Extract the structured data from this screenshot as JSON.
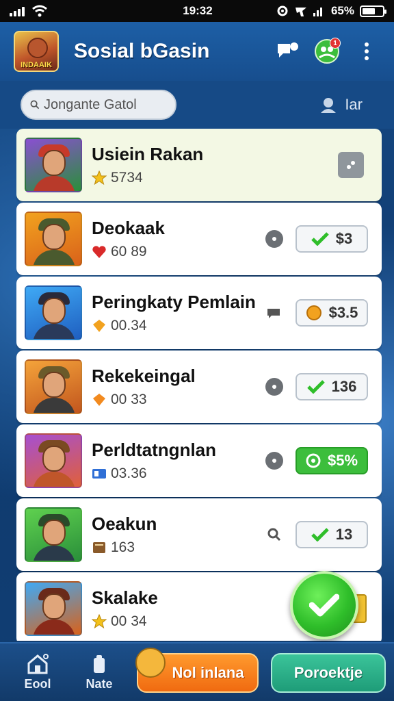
{
  "status_bar": {
    "time": "19:32",
    "battery": "65%",
    "battery_level": 0.65
  },
  "header": {
    "logo_text": "INDAAIK",
    "title": "Sosial bGasin",
    "notification_count": "1"
  },
  "search": {
    "placeholder": "Jongante Gatol",
    "side_label": "Iar"
  },
  "list": {
    "items": [
      {
        "name": "Usiein Rakan",
        "sub_value": "5734",
        "sub_icon": "star-icon",
        "action": ""
      },
      {
        "name": "Deokaak",
        "sub_value": "60 89",
        "sub_icon": "heart-icon",
        "action": "$3"
      },
      {
        "name": "Peringkaty Pemlain",
        "sub_value": "00.34",
        "sub_icon": "gem-icon",
        "action": "$3.5"
      },
      {
        "name": "Rekekeingal",
        "sub_value": "00 33",
        "sub_icon": "gem-icon",
        "action": "136"
      },
      {
        "name": "Perldtatngnlan",
        "sub_value": "03.36",
        "sub_icon": "id-card-icon",
        "action": "$5%"
      },
      {
        "name": "Oeakun",
        "sub_value": "163",
        "sub_icon": "book-icon",
        "action": "13"
      },
      {
        "name": "Skalake",
        "sub_value": "00 34",
        "sub_icon": "star-icon",
        "action": ""
      }
    ]
  },
  "bottom_nav": {
    "home_label": "Eool",
    "notes_label": "Nate",
    "primary_button": "Nol inlana",
    "secondary_button": "Poroektje"
  },
  "colors": {
    "accent_green": "#3cbe3c",
    "accent_orange": "#f06a10",
    "header_blue": "#1d5fa6"
  }
}
